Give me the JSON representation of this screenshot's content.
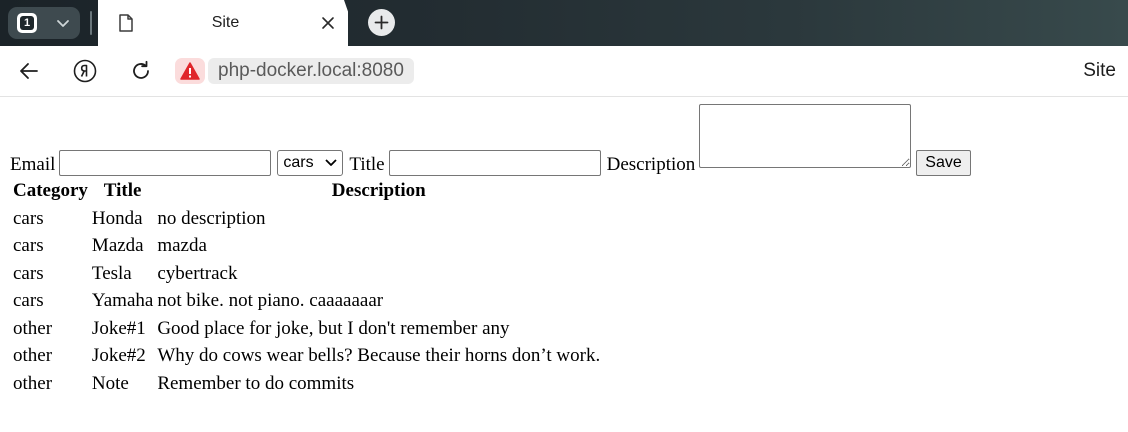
{
  "browser": {
    "tab_count": "1",
    "tab_title": "Site",
    "url": "php-docker.local:8080",
    "page_name": "Site"
  },
  "form": {
    "email_label": "Email",
    "email_value": "",
    "category_selected": "cars",
    "title_label": "Title",
    "title_value": "",
    "description_label": "Description",
    "description_value": "",
    "save_label": "Save"
  },
  "table": {
    "headers": [
      "Category",
      "Title",
      "Description"
    ],
    "rows": [
      {
        "category": "cars",
        "title": "Honda",
        "description": "no description"
      },
      {
        "category": "cars",
        "title": "Mazda",
        "description": "mazda"
      },
      {
        "category": "cars",
        "title": "Tesla",
        "description": "cybertrack"
      },
      {
        "category": "cars",
        "title": "Yamaha",
        "description": "not bike. not piano. caaaaaaar"
      },
      {
        "category": "other",
        "title": "Joke#1",
        "description": "Good place for joke, but I don't remember any"
      },
      {
        "category": "other",
        "title": "Joke#2",
        "description": "Why do cows wear bells? Because their horns don’t work."
      },
      {
        "category": "other",
        "title": "Note",
        "description": "Remember to do commits"
      }
    ]
  },
  "colors": {
    "security_warning": "#e0262b",
    "tabstrip_dark": "#1b2328"
  }
}
